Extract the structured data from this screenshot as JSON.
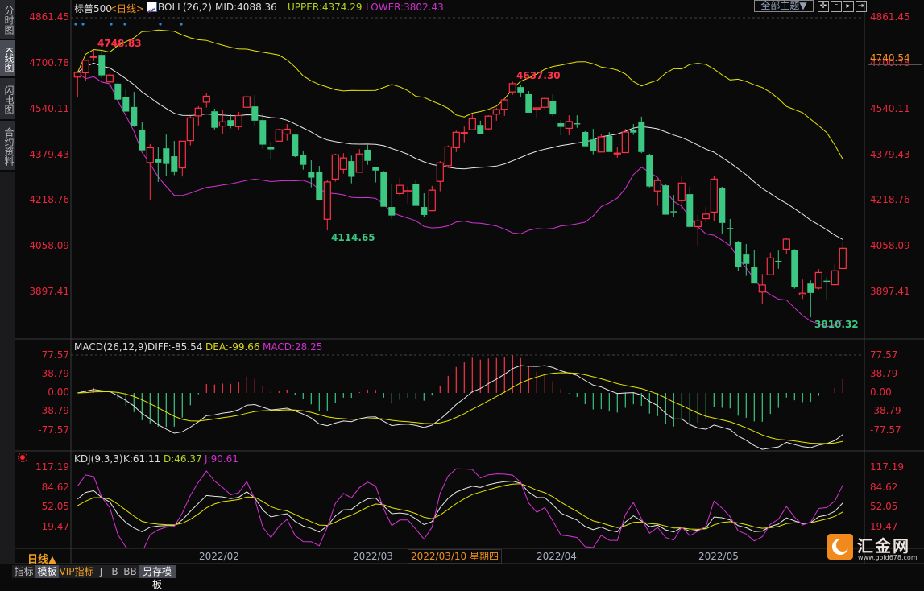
{
  "sidebar": {
    "tabs": [
      {
        "label": "分时图",
        "active": false
      },
      {
        "label": "K线图",
        "active": true
      },
      {
        "label": "闪电图",
        "active": false
      },
      {
        "label": "合约资料",
        "active": false
      }
    ]
  },
  "header": {
    "symbol": "标普500",
    "period": "<日线>",
    "boll": "BOLL(26,2)",
    "mid": "MID:4088.36",
    "upper": "UPPER:4374.29",
    "lower": "LOWER:3802.43",
    "theme_button": "全部主题▼",
    "tool_icons": [
      "crosshair-icon",
      "zoom-in-range-icon",
      "play-forward-icon",
      "move-right-icon"
    ]
  },
  "price_axis": {
    "ticks": [
      "4861.45",
      "4700.78",
      "4540.11",
      "4379.43",
      "4218.76",
      "4058.09",
      "3897.41"
    ],
    "current_price": "4740.54"
  },
  "annotations": {
    "high": "4748.83",
    "high2": "4637.30",
    "low": "4114.65",
    "low2": "3810.32"
  },
  "macd": {
    "title": "MACD(26,12,9)",
    "diff": "DIFF:-85.54",
    "dea": "DEA:-99.66",
    "macd": "MACD:28.25",
    "ticks": [
      "77.57",
      "38.79",
      "0.00",
      "-38.79",
      "-77.57"
    ]
  },
  "kdj": {
    "title": "KDJ(9,3,3)",
    "k": "K:61.11",
    "d": "D:46.37",
    "j": "J:90.61",
    "ticks": [
      "117.19",
      "84.62",
      "52.05",
      "19.47"
    ]
  },
  "date_axis": {
    "period_label": "日线▲",
    "labels": [
      "2022/02",
      "2022/03",
      "2022/04",
      "2022/05"
    ],
    "cursor_date": "2022/03/10 星期四"
  },
  "bottom_tabs": [
    {
      "label": "指标",
      "active": false
    },
    {
      "label": "模板",
      "active": true
    },
    {
      "label": "VIP指标",
      "active": false
    },
    {
      "label": "J",
      "active": false
    },
    {
      "label": "B",
      "active": false
    },
    {
      "label": "BB",
      "active": false
    },
    {
      "label": "另存模板",
      "active": true
    }
  ],
  "logo": {
    "name": "汇金网",
    "url_text": "www.gold678.com"
  },
  "colors": {
    "up": "#ff3348",
    "down": "#3cc882",
    "mid": "#e8e8e8",
    "upper": "#e6e600",
    "lower": "#d633d6",
    "axis_text": "#e8283c",
    "accent": "#f0901e"
  },
  "chart_data": {
    "type": "candlestick",
    "fields": [
      "open",
      "high",
      "low",
      "close"
    ],
    "candles": [
      [
        4653,
        4671,
        4582,
        4669
      ],
      [
        4668,
        4714,
        4639,
        4712
      ],
      [
        4725,
        4749,
        4709,
        4725
      ],
      [
        4731,
        4745,
        4650,
        4659
      ],
      [
        4636,
        4666,
        4618,
        4660
      ],
      [
        4630,
        4633,
        4573,
        4574
      ],
      [
        4584,
        4613,
        4532,
        4532
      ],
      [
        4548,
        4601,
        4478,
        4481
      ],
      [
        4466,
        4494,
        4396,
        4396
      ],
      [
        4353,
        4418,
        4220,
        4405
      ],
      [
        4364,
        4409,
        4285,
        4353
      ],
      [
        4403,
        4451,
        4305,
        4348
      ],
      [
        4375,
        4429,
        4309,
        4322
      ],
      [
        4334,
        4429,
        4304,
        4428
      ],
      [
        4430,
        4516,
        4413,
        4510
      ],
      [
        4517,
        4551,
        4483,
        4544
      ],
      [
        4565,
        4596,
        4546,
        4586
      ],
      [
        4533,
        4542,
        4469,
        4475
      ],
      [
        4481,
        4539,
        4452,
        4496
      ],
      [
        4502,
        4522,
        4473,
        4481
      ],
      [
        4479,
        4531,
        4466,
        4518
      ],
      [
        4547,
        4589,
        4546,
        4584
      ],
      [
        4550,
        4590,
        4483,
        4500
      ],
      [
        4502,
        4526,
        4401,
        4416
      ],
      [
        4409,
        4426,
        4366,
        4399
      ],
      [
        4428,
        4471,
        4428,
        4468
      ],
      [
        4453,
        4488,
        4430,
        4470
      ],
      [
        4451,
        4454,
        4372,
        4375
      ],
      [
        4381,
        4392,
        4328,
        4345
      ],
      [
        4321,
        4361,
        4266,
        4300
      ],
      [
        4321,
        4341,
        4220,
        4220
      ],
      [
        4154,
        4292,
        4115,
        4285
      ],
      [
        4295,
        4384,
        4286,
        4380
      ],
      [
        4329,
        4386,
        4314,
        4369
      ],
      [
        4358,
        4377,
        4280,
        4303
      ],
      [
        4319,
        4400,
        4319,
        4383
      ],
      [
        4398,
        4415,
        4345,
        4359
      ],
      [
        4338,
        4338,
        4283,
        4325
      ],
      [
        4321,
        4323,
        4198,
        4198
      ],
      [
        4197,
        4276,
        4155,
        4167
      ],
      [
        4244,
        4299,
        4235,
        4273
      ],
      [
        4250,
        4269,
        4209,
        4254
      ],
      [
        4279,
        4290,
        4201,
        4201
      ],
      [
        4197,
        4245,
        4161,
        4169
      ],
      [
        4184,
        4271,
        4184,
        4256
      ],
      [
        4287,
        4358,
        4252,
        4352
      ],
      [
        4342,
        4413,
        4334,
        4408
      ],
      [
        4405,
        4465,
        4390,
        4459
      ],
      [
        4455,
        4479,
        4424,
        4458
      ],
      [
        4468,
        4522,
        4468,
        4507
      ],
      [
        4485,
        4500,
        4452,
        4452
      ],
      [
        4471,
        4519,
        4466,
        4516
      ],
      [
        4523,
        4545,
        4500,
        4539
      ],
      [
        4540,
        4579,
        4517,
        4573
      ],
      [
        4601,
        4637,
        4591,
        4630
      ],
      [
        4618,
        4627,
        4582,
        4599
      ],
      [
        4593,
        4604,
        4528,
        4528
      ],
      [
        4541,
        4548,
        4509,
        4545
      ],
      [
        4547,
        4583,
        4540,
        4578
      ],
      [
        4570,
        4593,
        4515,
        4522
      ],
      [
        4491,
        4502,
        4449,
        4478
      ],
      [
        4473,
        4519,
        4449,
        4497
      ],
      [
        4491,
        4519,
        4475,
        4487
      ],
      [
        4460,
        4463,
        4410,
        4410
      ],
      [
        4434,
        4471,
        4382,
        4393
      ],
      [
        4390,
        4454,
        4390,
        4443
      ],
      [
        4446,
        4460,
        4390,
        4390
      ],
      [
        4384,
        4409,
        4370,
        4386
      ],
      [
        4388,
        4471,
        4388,
        4460
      ],
      [
        4468,
        4488,
        4450,
        4458
      ],
      [
        4497,
        4514,
        4386,
        4390
      ],
      [
        4378,
        4384,
        4266,
        4269
      ],
      [
        4253,
        4297,
        4201,
        4290
      ],
      [
        4273,
        4276,
        4170,
        4170
      ],
      [
        4182,
        4239,
        4161,
        4178
      ],
      [
        4219,
        4307,
        4189,
        4281
      ],
      [
        4242,
        4268,
        4123,
        4127
      ],
      [
        4128,
        4170,
        4059,
        4148
      ],
      [
        4156,
        4198,
        4144,
        4172
      ],
      [
        4179,
        4307,
        4146,
        4295
      ],
      [
        4265,
        4268,
        4104,
        4141
      ],
      [
        4123,
        4155,
        4064,
        4119
      ],
      [
        4075,
        4078,
        3972,
        3985
      ],
      [
        4030,
        4067,
        3955,
        3997
      ],
      [
        3985,
        4047,
        3928,
        3928
      ],
      [
        3898,
        3962,
        3856,
        3923
      ],
      [
        3959,
        4037,
        3959,
        4018
      ],
      [
        4008,
        4044,
        3980,
        4004
      ],
      [
        4049,
        4088,
        4031,
        4084
      ],
      [
        4047,
        4049,
        3910,
        3917
      ],
      [
        3888,
        3942,
        3874,
        3894
      ],
      [
        3928,
        3939,
        3810,
        3895
      ],
      [
        3912,
        3979,
        3907,
        3967
      ],
      [
        3938,
        3951,
        3873,
        3934
      ],
      [
        3924,
        3996,
        3921,
        3973
      ],
      [
        3981,
        4072,
        3981,
        4052
      ]
    ],
    "indicators": [
      "BOLL(26,2)",
      "MACD(26,12,9)",
      "KDJ(9,3,3)"
    ],
    "price_range": [
      3810.32,
      4861.45
    ]
  }
}
